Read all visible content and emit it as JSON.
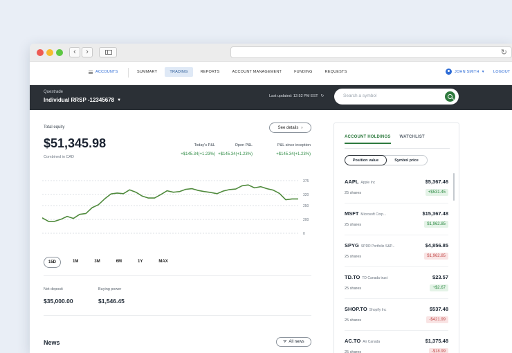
{
  "browser": {
    "back": "‹",
    "forward": "›",
    "reload": "↻"
  },
  "nav": {
    "accounts": "ACCOUNTS",
    "tabs": [
      "SUMMARY",
      "TRADING",
      "REPORTS",
      "ACCOUNT MANAGEMENT",
      "FUNDING",
      "REQUESTS"
    ],
    "active_tab": "TRADING",
    "user": "JOHN SMITH",
    "logout": "LOGOUT"
  },
  "account": {
    "brand": "Questrade",
    "name": "Individual RRSP -12345678",
    "last_updated": "Last updated: 12:52 PM EST",
    "search_placeholder": "Search a symbol"
  },
  "summary": {
    "total_equity_label": "Total equity",
    "total_equity": "$51,345.98",
    "combined": "Combined in CAD",
    "see_details": "See details",
    "pnl": [
      {
        "label": "Today's P&L",
        "value": "+$145.34(+1.23%)"
      },
      {
        "label": "Open P&L",
        "value": "+$145.34(+1.23%)"
      },
      {
        "label": "P&L since inception",
        "value": "+$145.34(+1.23%)"
      }
    ]
  },
  "chart_data": {
    "type": "line",
    "y_ticks": [
      "375",
      "320",
      "250",
      "200",
      "0"
    ],
    "series": [
      {
        "values": [
          210,
          198,
          198,
          205,
          215,
          208,
          222,
          225,
          245,
          255,
          275,
          292,
          295,
          293,
          306,
          298,
          285,
          278,
          278,
          290,
          303,
          298,
          300,
          308,
          310,
          304,
          300,
          297,
          293,
          302,
          307,
          309,
          320,
          323,
          313,
          317,
          310,
          305,
          294,
          272,
          275,
          275
        ]
      }
    ],
    "ranges": [
      "15D",
      "1M",
      "3M",
      "6M",
      "1Y",
      "MAX"
    ],
    "active_range": "15D",
    "color": "#4f8a3c"
  },
  "balances": {
    "net_deposit_label": "Net deposit",
    "net_deposit": "$35,000.00",
    "buying_power_label": "Buying power",
    "buying_power": "$1,546.45"
  },
  "news": {
    "title": "News",
    "all_news": "All news"
  },
  "holdings": {
    "tabs": [
      "ACCOUNT HOLDINGS",
      "WATCHLIST"
    ],
    "toggle": [
      "Position value",
      "Symbol price"
    ],
    "rows": [
      {
        "symbol": "AAPL",
        "name": "Apple Inc",
        "shares": "25 shares",
        "price": "$5,367.46",
        "change": "+$531.45",
        "dir": "up"
      },
      {
        "symbol": "MSFT",
        "name": "Microsoft Corp...",
        "shares": "25 shares",
        "price": "$15,367.48",
        "change": "$1,962.85",
        "dir": "up"
      },
      {
        "symbol": "SPYG",
        "name": "SPDR Portfolio S&P...",
        "shares": "25 shares",
        "price": "$4,856.85",
        "change": "$1,962.85",
        "dir": "down"
      },
      {
        "symbol": "TD.TO",
        "name": "TD Canada trust",
        "shares": "25 shares",
        "price": "$23.57",
        "change": "+$2.67",
        "dir": "up"
      },
      {
        "symbol": "SHOP.TO",
        "name": "Shopify Inc",
        "shares": "25 shares",
        "price": "$537.48",
        "change": "-$421.99",
        "dir": "down"
      },
      {
        "symbol": "AC.TO",
        "name": "Air Canada",
        "shares": "25 shares",
        "price": "$1,375.48",
        "change": "-$18.99",
        "dir": "down"
      }
    ]
  }
}
